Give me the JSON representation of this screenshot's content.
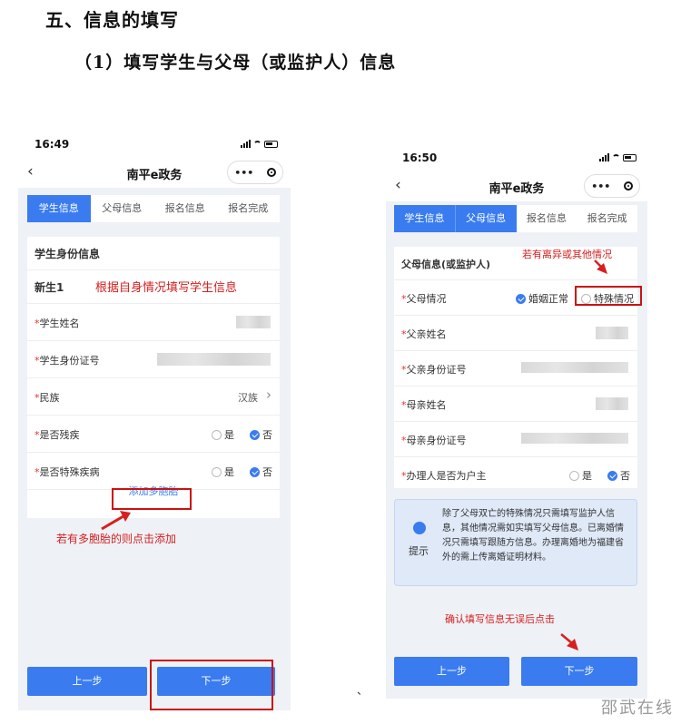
{
  "doc": {
    "heading1": "五、信息的填写",
    "heading2": "（1）填写学生与父母（或监护人）信息",
    "watermark": "邵武在线",
    "stray_mark": "、"
  },
  "colors": {
    "accent": "#3a7cf0",
    "annotation": "#d62020"
  },
  "left_phone": {
    "time": "16:49",
    "title": "南平e政务",
    "capsule_more": "•••",
    "tabs": [
      "学生信息",
      "父母信息",
      "报名信息",
      "报名完成"
    ],
    "active_tab": 0,
    "section_title": "学生身份信息",
    "new_student_label": "新生1",
    "annotation_top": "根据自身情况填写学生信息",
    "fields": {
      "name_req": "*",
      "name_label": "学生姓名",
      "id_req": "*",
      "id_label": "学生身份证号",
      "ethnic_req": "*",
      "ethnic_label": "民族",
      "ethnic_value": "汉族",
      "disabled_req": "*",
      "disabled_label": "是否残疾",
      "special_req": "*",
      "special_label": "是否特殊疾病"
    },
    "yes": "是",
    "no": "否",
    "add_twins": "添加多胞胎",
    "annotation_bottom": "若有多胞胎的则点击添加",
    "prev_btn": "上一步",
    "next_btn": "下一步"
  },
  "right_phone": {
    "time": "16:50",
    "title": "南平e政务",
    "capsule_more": "•••",
    "tabs": [
      "学生信息",
      "父母信息",
      "报名信息",
      "报名完成"
    ],
    "active_tabs": [
      0,
      1
    ],
    "section_title": "父母信息(或监护人)",
    "annotation_top": "若有离异或其他情况",
    "fields": {
      "status_req": "*",
      "status_label": "父母情况",
      "status_normal": "婚姻正常",
      "status_special": "特殊情况",
      "father_name_req": "*",
      "father_name_label": "父亲姓名",
      "father_id_req": "*",
      "father_id_label": "父亲身份证号",
      "mother_name_req": "*",
      "mother_name_label": "母亲姓名",
      "mother_id_req": "*",
      "mother_id_label": "母亲身份证号",
      "holder_req": "*",
      "holder_label": "办理人是否为户主"
    },
    "yes": "是",
    "no": "否",
    "tip_label": "提示",
    "tip_text": "除了父母双亡的特殊情况只需填写监护人信息，其他情况需如实填写父母信息。已离婚情况只需填写跟随方信息。办理离婚地为福建省外的需上传离婚证明材料。",
    "annotation_bottom": "确认填写信息无误后点击",
    "prev_btn": "上一步",
    "next_btn": "下一步"
  }
}
